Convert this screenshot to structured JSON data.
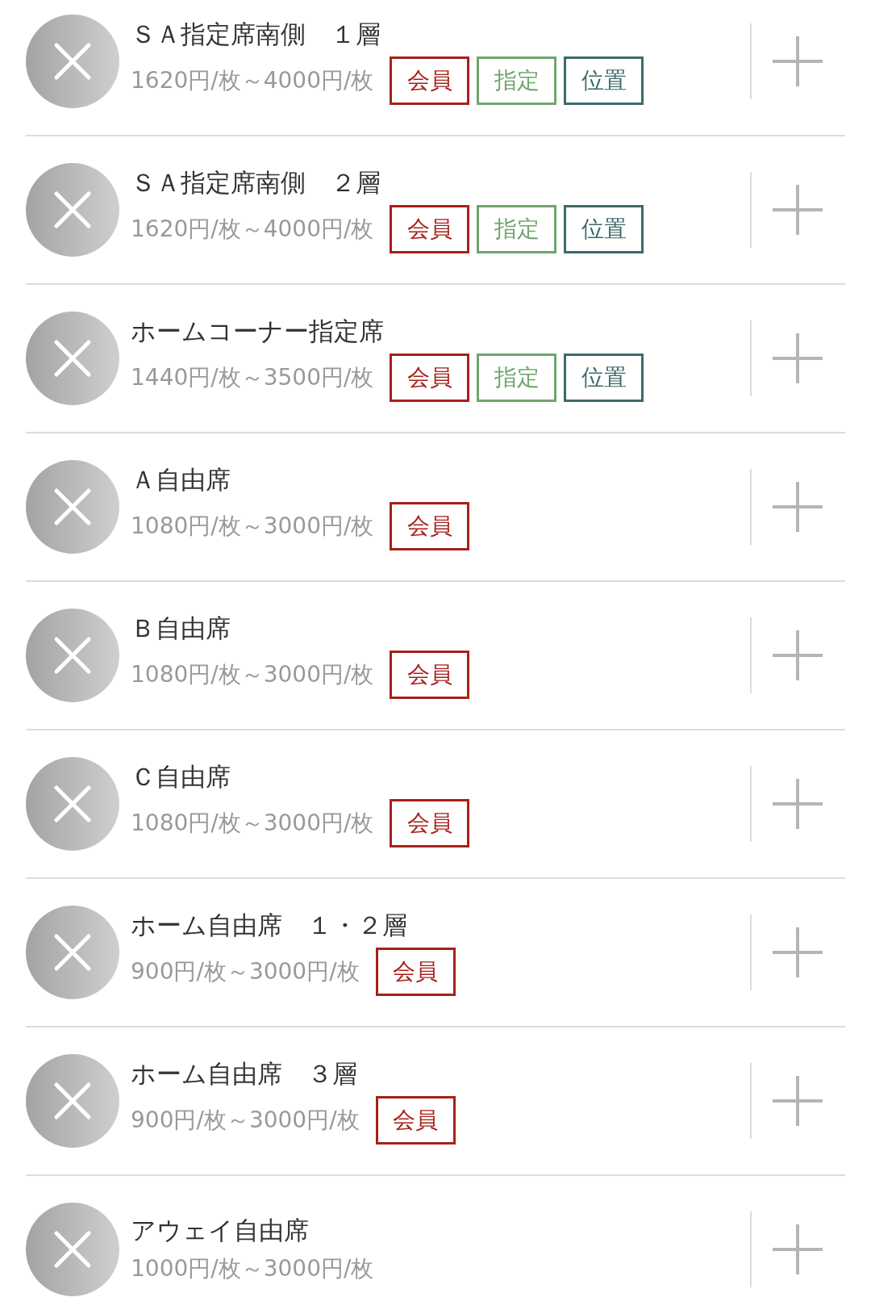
{
  "items": [
    {
      "title": "ＳＡ指定席南側　１層",
      "price": "1620円/枚～4000円/枚",
      "tags": [
        {
          "kind": "member",
          "label": "会員"
        },
        {
          "kind": "reserved",
          "label": "指定"
        },
        {
          "kind": "position",
          "label": "位置"
        }
      ]
    },
    {
      "title": "ＳＡ指定席南側　２層",
      "price": "1620円/枚～4000円/枚",
      "tags": [
        {
          "kind": "member",
          "label": "会員"
        },
        {
          "kind": "reserved",
          "label": "指定"
        },
        {
          "kind": "position",
          "label": "位置"
        }
      ]
    },
    {
      "title": "ホームコーナー指定席",
      "price": "1440円/枚～3500円/枚",
      "tags": [
        {
          "kind": "member",
          "label": "会員"
        },
        {
          "kind": "reserved",
          "label": "指定"
        },
        {
          "kind": "position",
          "label": "位置"
        }
      ]
    },
    {
      "title": "Ａ自由席",
      "price": "1080円/枚～3000円/枚",
      "tags": [
        {
          "kind": "member",
          "label": "会員"
        }
      ]
    },
    {
      "title": "Ｂ自由席",
      "price": "1080円/枚～3000円/枚",
      "tags": [
        {
          "kind": "member",
          "label": "会員"
        }
      ]
    },
    {
      "title": "Ｃ自由席",
      "price": "1080円/枚～3000円/枚",
      "tags": [
        {
          "kind": "member",
          "label": "会員"
        }
      ]
    },
    {
      "title": "ホーム自由席　１・２層",
      "price": "900円/枚～3000円/枚",
      "tags": [
        {
          "kind": "member",
          "label": "会員"
        }
      ]
    },
    {
      "title": "ホーム自由席　３層",
      "price": "900円/枚～3000円/枚",
      "tags": [
        {
          "kind": "member",
          "label": "会員"
        }
      ]
    },
    {
      "title": "アウェイ自由席",
      "price": "1000円/枚～3000円/枚"
    }
  ]
}
